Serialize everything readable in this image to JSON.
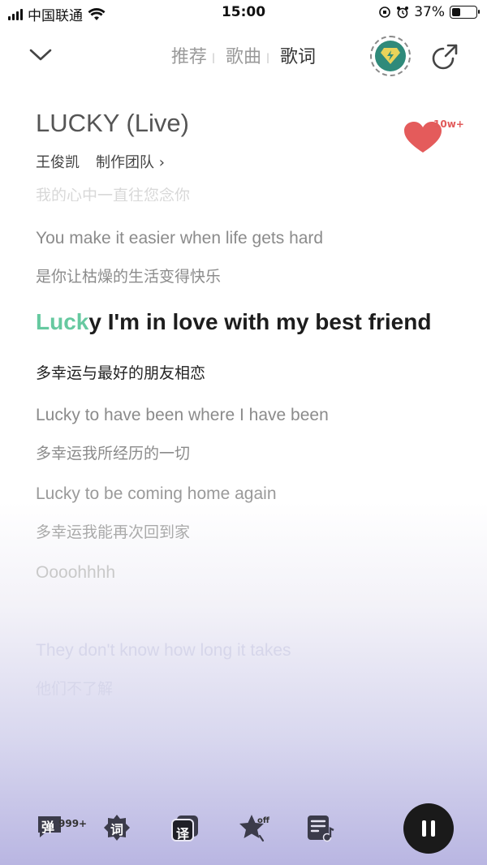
{
  "status": {
    "carrier": "中国联通",
    "time": "15:00",
    "battery": "37%",
    "battery_level": 0.37
  },
  "nav": {
    "tabs": [
      "推荐",
      "歌曲",
      "歌词"
    ],
    "active_tab": "歌词"
  },
  "song": {
    "title": "LUCKY (Live)",
    "artist": "王俊凯",
    "credits": "制作团队 ›",
    "like_count": "10w+",
    "accent": "#66c9a0",
    "like_color": "#e45b5b"
  },
  "lyrics": {
    "top_faded": "我的心中一直往您念你",
    "l1_en": "You make it easier when life gets hard",
    "l1_zh": "是你让枯燥的生活变得快乐",
    "current_highlight": "Luck",
    "current_rest": "y I'm in love with my best friend",
    "current_zh": "多幸运与最好的朋友相恋",
    "l3_en": "Lucky to have been where I have been",
    "l3_zh": "多幸运我所经历的一切",
    "l4_en": "Lucky to be coming home again",
    "l4_zh": "多幸运我能再次回到家",
    "l5_en": "Oooohhhh",
    "l6_en": "They don't know how long it takes",
    "l6_zh": "他们不了解"
  },
  "toolbar": {
    "danmu_label": "弹",
    "danmu_count": "999+",
    "lyric_label": "词",
    "translate_label": "译",
    "star_badge": "off"
  }
}
